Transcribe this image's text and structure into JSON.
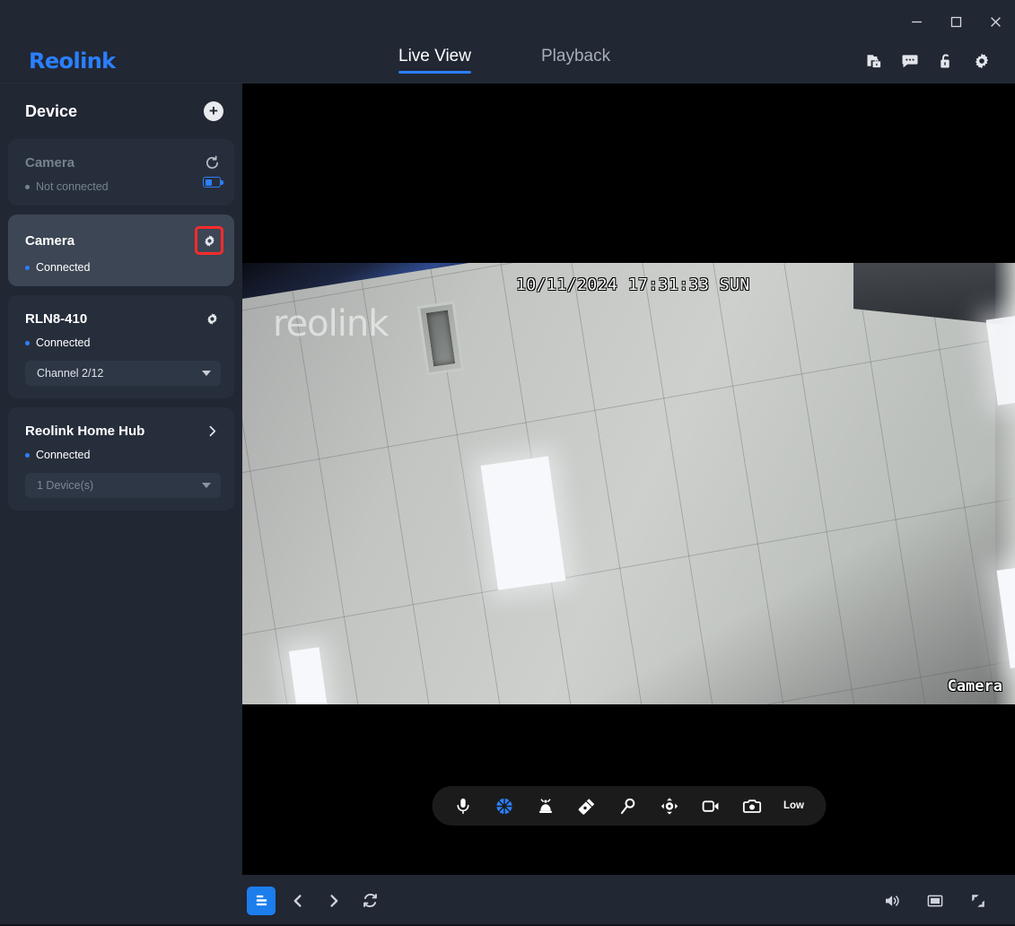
{
  "window": {
    "controls": [
      {
        "name": "minimize",
        "glyph": "–"
      },
      {
        "name": "maximize",
        "glyph": "□"
      },
      {
        "name": "close",
        "glyph": "✕"
      }
    ]
  },
  "header": {
    "logo": "Reolink",
    "tabs": [
      {
        "label": "Live View",
        "active": true
      },
      {
        "label": "Playback",
        "active": false
      }
    ],
    "icons": [
      {
        "name": "files-lock-icon"
      },
      {
        "name": "chat-bubble-icon"
      },
      {
        "name": "unlock-icon"
      },
      {
        "name": "gear-icon"
      }
    ]
  },
  "sidebar": {
    "title": "Device",
    "add_label": "+",
    "devices": [
      {
        "name": "Camera",
        "status": "Not connected",
        "online": false,
        "action_icon": "refresh-icon",
        "battery": {
          "level_pct": 50
        },
        "selected": false,
        "highlight": false
      },
      {
        "name": "Camera",
        "status": "Connected",
        "online": true,
        "action_icon": "gear-icon",
        "selected": true,
        "highlight": true
      },
      {
        "name": "RLN8-410",
        "status": "Connected",
        "online": true,
        "action_icon": "gear-icon",
        "selected": false,
        "highlight": false,
        "dropdown": {
          "value": "Channel 2/12",
          "muted": false
        }
      },
      {
        "name": "Reolink Home Hub",
        "status": "Connected",
        "online": true,
        "action_icon": "chevron-right-icon",
        "selected": false,
        "highlight": false,
        "dropdown": {
          "value": "1 Device(s)",
          "muted": true
        }
      }
    ]
  },
  "video": {
    "osd_timestamp": "10/11/2024 17:31:33 SUN",
    "osd_camera_name": "Camera",
    "watermark": "reolink"
  },
  "toolbar": {
    "items": [
      {
        "name": "microphone-icon",
        "label": "",
        "accent": false
      },
      {
        "name": "siren-icon",
        "label": "",
        "accent": true
      },
      {
        "name": "alarm-icon",
        "label": "",
        "accent": false
      },
      {
        "name": "flashlight-icon",
        "label": "",
        "accent": false
      },
      {
        "name": "zoom-icon",
        "label": "",
        "accent": false
      },
      {
        "name": "ptz-icon",
        "label": "",
        "accent": false
      },
      {
        "name": "record-video-icon",
        "label": "",
        "accent": false
      },
      {
        "name": "snapshot-icon",
        "label": "",
        "accent": false
      }
    ],
    "quality_label": "Low"
  },
  "bottombar": {
    "left": [
      {
        "name": "layout-icon",
        "active": true
      },
      {
        "name": "prev-icon",
        "active": false
      },
      {
        "name": "next-icon",
        "active": false
      },
      {
        "name": "refresh-icon",
        "active": false
      }
    ],
    "right": [
      {
        "name": "volume-icon"
      },
      {
        "name": "screen-icon"
      },
      {
        "name": "fullscreen-icon"
      }
    ]
  },
  "colors": {
    "accent": "#2b7fff",
    "panel": "#212733",
    "card": "#272e3b",
    "card_selected": "#3c4654",
    "highlight_box": "#ff2b2b",
    "text": "#ffffff",
    "muted": "#77818f"
  }
}
